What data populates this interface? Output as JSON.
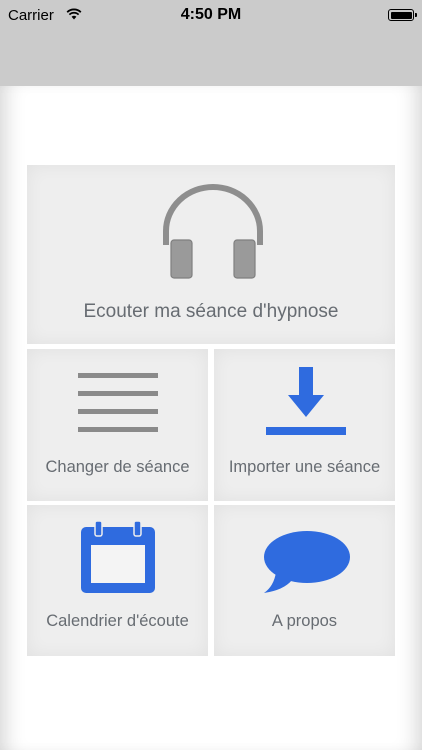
{
  "status_bar": {
    "carrier": "Carrier",
    "time": "4:50 PM"
  },
  "menu": {
    "listen_label": "Ecouter ma séance d'hypnose",
    "change_label": "Changer de séance",
    "import_label": "Importer une séance",
    "calendar_label": "Calendrier d'écoute",
    "about_label": "A propos"
  },
  "icons": {
    "listen": "headphones-icon",
    "change": "list-icon",
    "import": "download-icon",
    "calendar": "calendar-icon",
    "about": "speech-bubble-icon"
  },
  "colors": {
    "accent_blue": "#2f6bdf",
    "icon_gray": "#9a9a9a",
    "tile_bg": "#eeeeee",
    "label_gray": "#676c72",
    "nav_bar": "#cbcbcb"
  }
}
